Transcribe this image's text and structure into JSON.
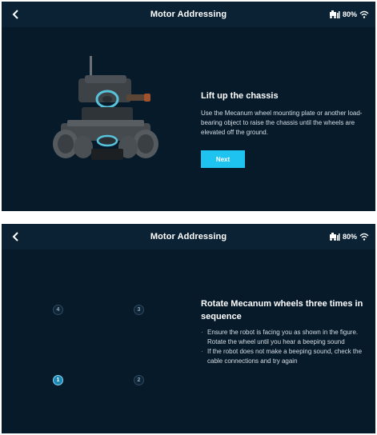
{
  "screens": [
    {
      "header": {
        "title": "Motor Addressing",
        "battery": "80%"
      },
      "instruction": {
        "title": "Lift up the chassis",
        "body": "Use the Mecanum wheel mounting plate or another load-bearing object to raise the chassis until the wheels are elevated off the ground."
      },
      "next_button": "Next"
    },
    {
      "header": {
        "title": "Motor Addressing",
        "battery": "80%"
      },
      "wheels": [
        {
          "label": "4",
          "active": false
        },
        {
          "label": "3",
          "active": false
        },
        {
          "label": "1",
          "active": true
        },
        {
          "label": "2",
          "active": false
        }
      ],
      "instruction": {
        "title": "Rotate Mecanum wheels three times in sequence",
        "steps": [
          "Ensure the robot is facing you as shown in the figure. Rotate the wheel until you hear a beeping sound",
          "If the robot does not make a beeping sound, check the cable connections and try again"
        ]
      }
    }
  ],
  "colors": {
    "accent": "#1ec3f0",
    "background": "#071a29",
    "header": "#0b2234"
  },
  "icons": [
    "back-icon",
    "robot-status-icon",
    "wifi-icon"
  ]
}
